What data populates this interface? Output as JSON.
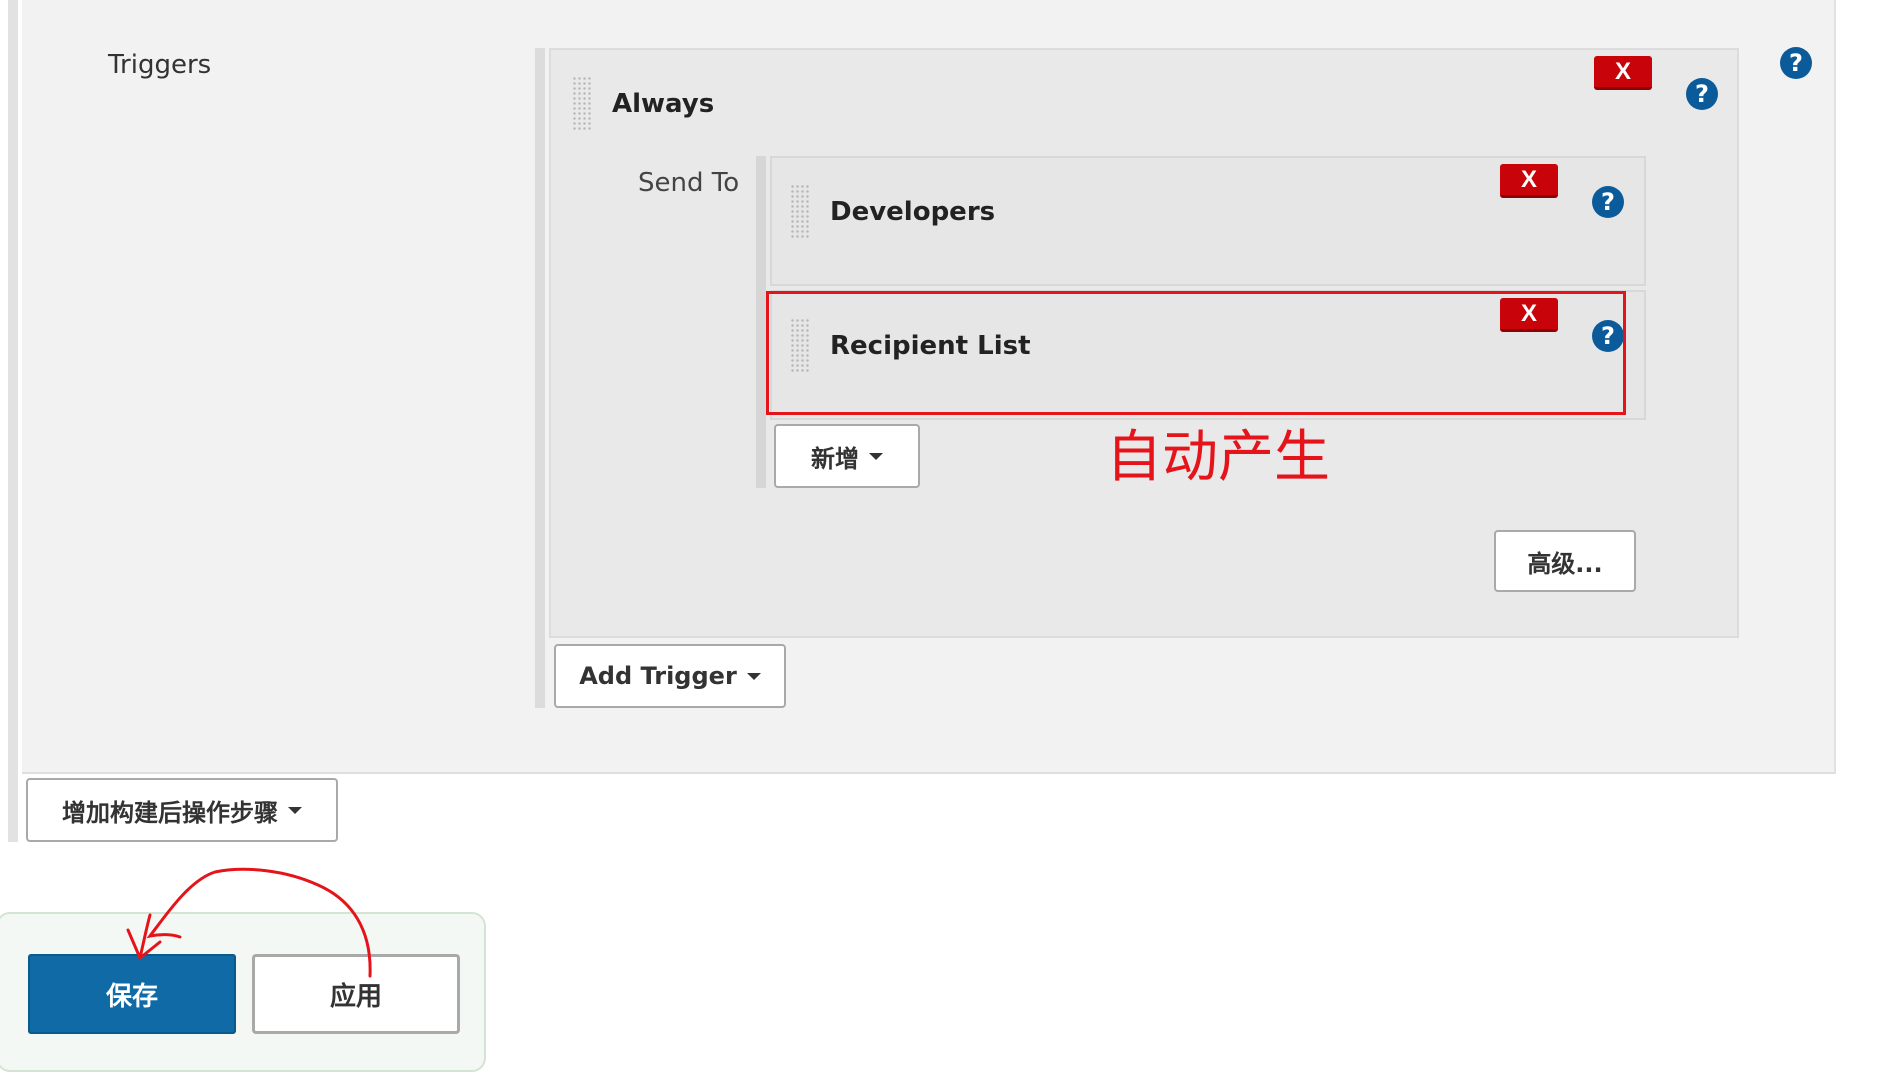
{
  "triggers_section": {
    "label": "Triggers"
  },
  "trigger": {
    "title": "Always",
    "delete_label": "X",
    "send_to_label": "Send To",
    "recipients": [
      {
        "title": "Developers",
        "delete_label": "X"
      },
      {
        "title": "Recipient List",
        "delete_label": "X"
      }
    ],
    "add_recipient_button": "新增",
    "advanced_button": "高级..."
  },
  "help_icon_glyph": "?",
  "add_trigger_button": "Add Trigger",
  "add_post_build_button": "增加构建后操作步骤",
  "footer": {
    "save_button": "保存",
    "apply_button": "应用"
  },
  "annotation": {
    "text": "自动产生",
    "color": "#e5141b"
  },
  "colors": {
    "delete_button": "#c8040a",
    "help_icon": "#0b5b9b",
    "save_button": "#0f6aa5"
  }
}
